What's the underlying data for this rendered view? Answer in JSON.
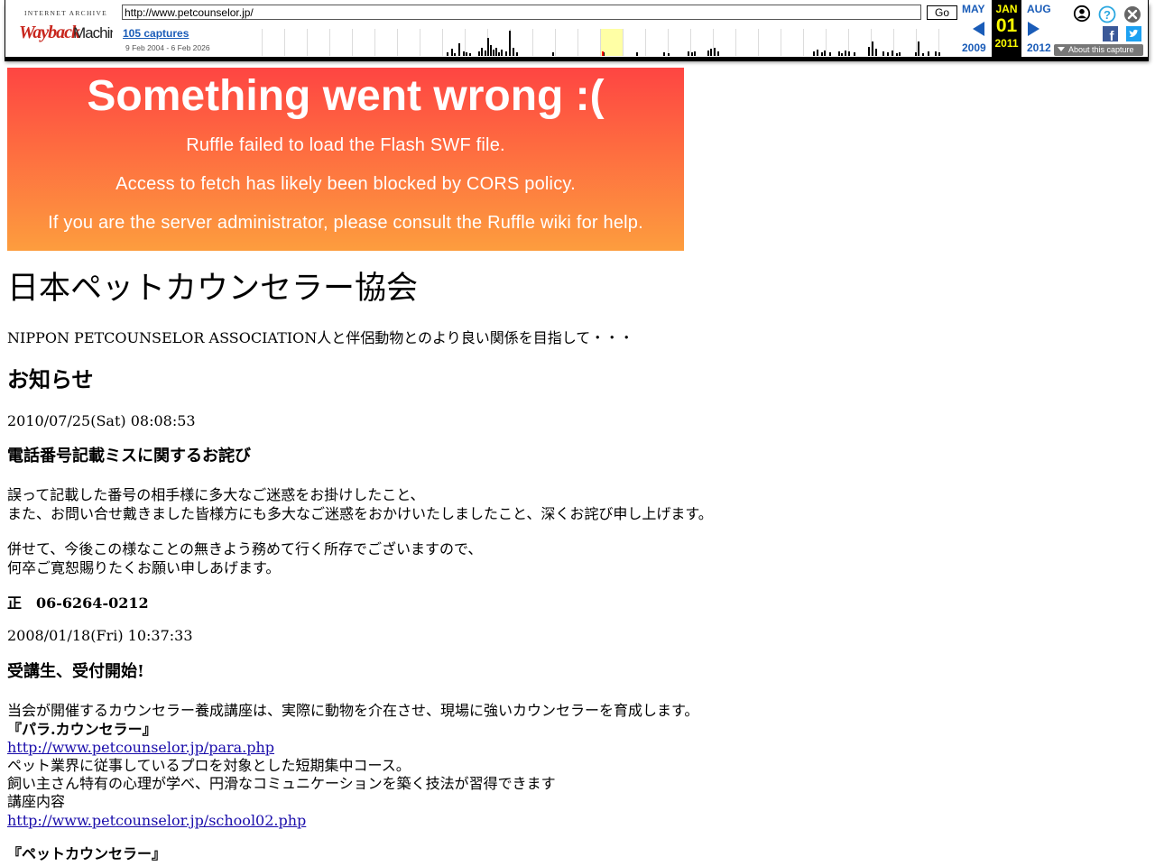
{
  "toolbar": {
    "ia_text": "INTERNET ARCHIVE",
    "logo_text": "WaybackMachine",
    "url": "http://www.petcounselor.jp/",
    "go_label": "Go",
    "captures_link": "105 captures",
    "capture_range": "9 Feb 2004 - 6 Feb 2026",
    "prev_month": "MAY",
    "cur_month": "JAN",
    "next_month": "AUG",
    "prev_year": "2009",
    "cur_day": "01",
    "cur_year": "2011",
    "next_year": "2012",
    "about_label": "About this capture",
    "accent_color": "#1a5cb8",
    "highlight_color": "#ffff00"
  },
  "ruffle": {
    "title": "Something went wrong :(",
    "line1": "Ruffle failed to load the Flash SWF file.",
    "line2": "Access to fetch has likely been blocked by CORS policy.",
    "line3": "If you are the server administrator, please consult the Ruffle wiki for help.",
    "gradient_top": "#fe4542",
    "gradient_bottom": "#fd9d3e"
  },
  "page": {
    "site_title": "日本ペットカウンセラー協会",
    "tagline": "NIPPON PETCOUNSELOR ASSOCIATION人と伴侶動物とのより良い関係を目指して・・・",
    "news_heading": "お知らせ",
    "news": [
      {
        "date": "2010/07/25(Sat) 08:08:53",
        "title": "電話番号記載ミスに関するお詫び",
        "p1_l1": "誤って記載した番号の相手様に多大なご迷惑をお掛けしたこと、",
        "p1_l2": "また、お問い合せ戴きました皆様方にも多大なご迷惑をおかけいたしましたこと、深くお詫び申し上げます。",
        "p2_l1": "併せて、今後この様なことの無きよう務めて行く所存でございますので、",
        "p2_l2": "何卒ご寛恕賜りたくお願い申しあげます。",
        "phone": "正　06-6264-0212"
      },
      {
        "date": "2008/01/18(Fri) 10:37:33",
        "title": "受講生、受付開始!",
        "intro": "当会が開催するカウンセラー養成講座は、実際に動物を介在させ、現場に強いカウンセラーを育成します。",
        "course1": "『パラ.カウンセラー』",
        "link1": "http://www.petcounselor.jp/para.php",
        "desc1": "ペット業界に従事しているプロを対象とした短期集中コース。",
        "desc2": "飼い主さん特有の心理が学べ、円滑なコミュニケーションを築く技法が習得できます",
        "desc3": "講座内容",
        "link2": "http://www.petcounselor.jp/school02.php",
        "course2": "『ペットカウンセラー』"
      }
    ]
  }
}
